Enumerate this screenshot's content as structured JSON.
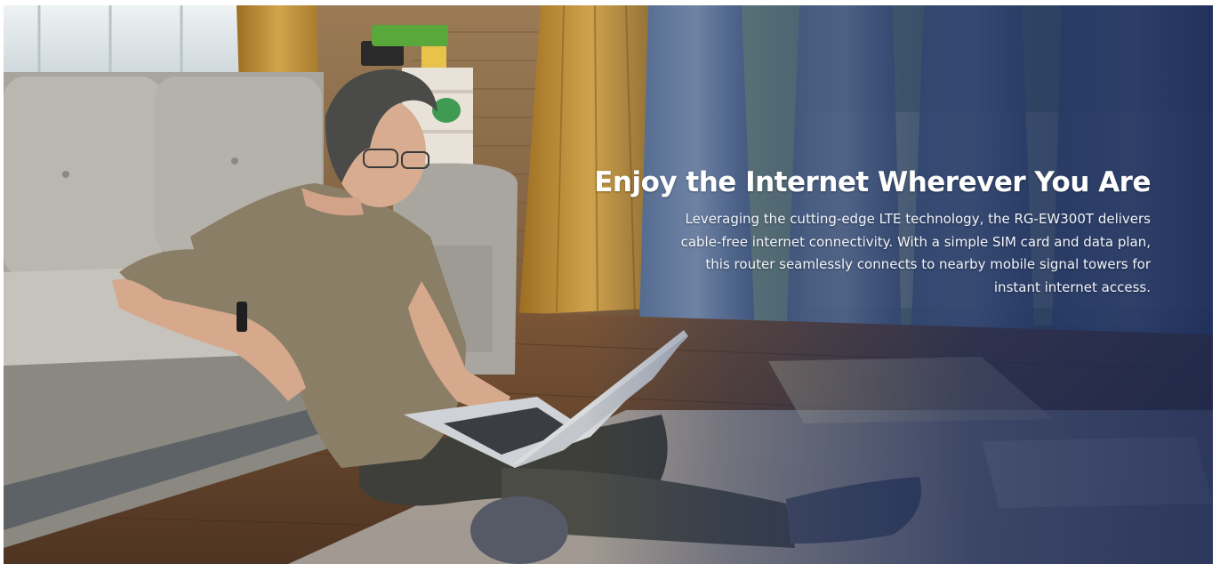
{
  "banner": {
    "headline": "Enjoy the Internet Wherever You Are",
    "description": "Leveraging the cutting-edge LTE technology, the RG-EW300T delivers cable-free internet connectivity. With a simple SIM card and data plan, this router seamlessly connects to nearby mobile signal towers for instant internet access."
  },
  "colors": {
    "overlay": "#142656",
    "text": "#ffffff",
    "floor": "#6b4a30",
    "sofa": "#b9b6b0",
    "curtain_gold": "#c09039",
    "curtain_blue": "#6d86a8"
  }
}
